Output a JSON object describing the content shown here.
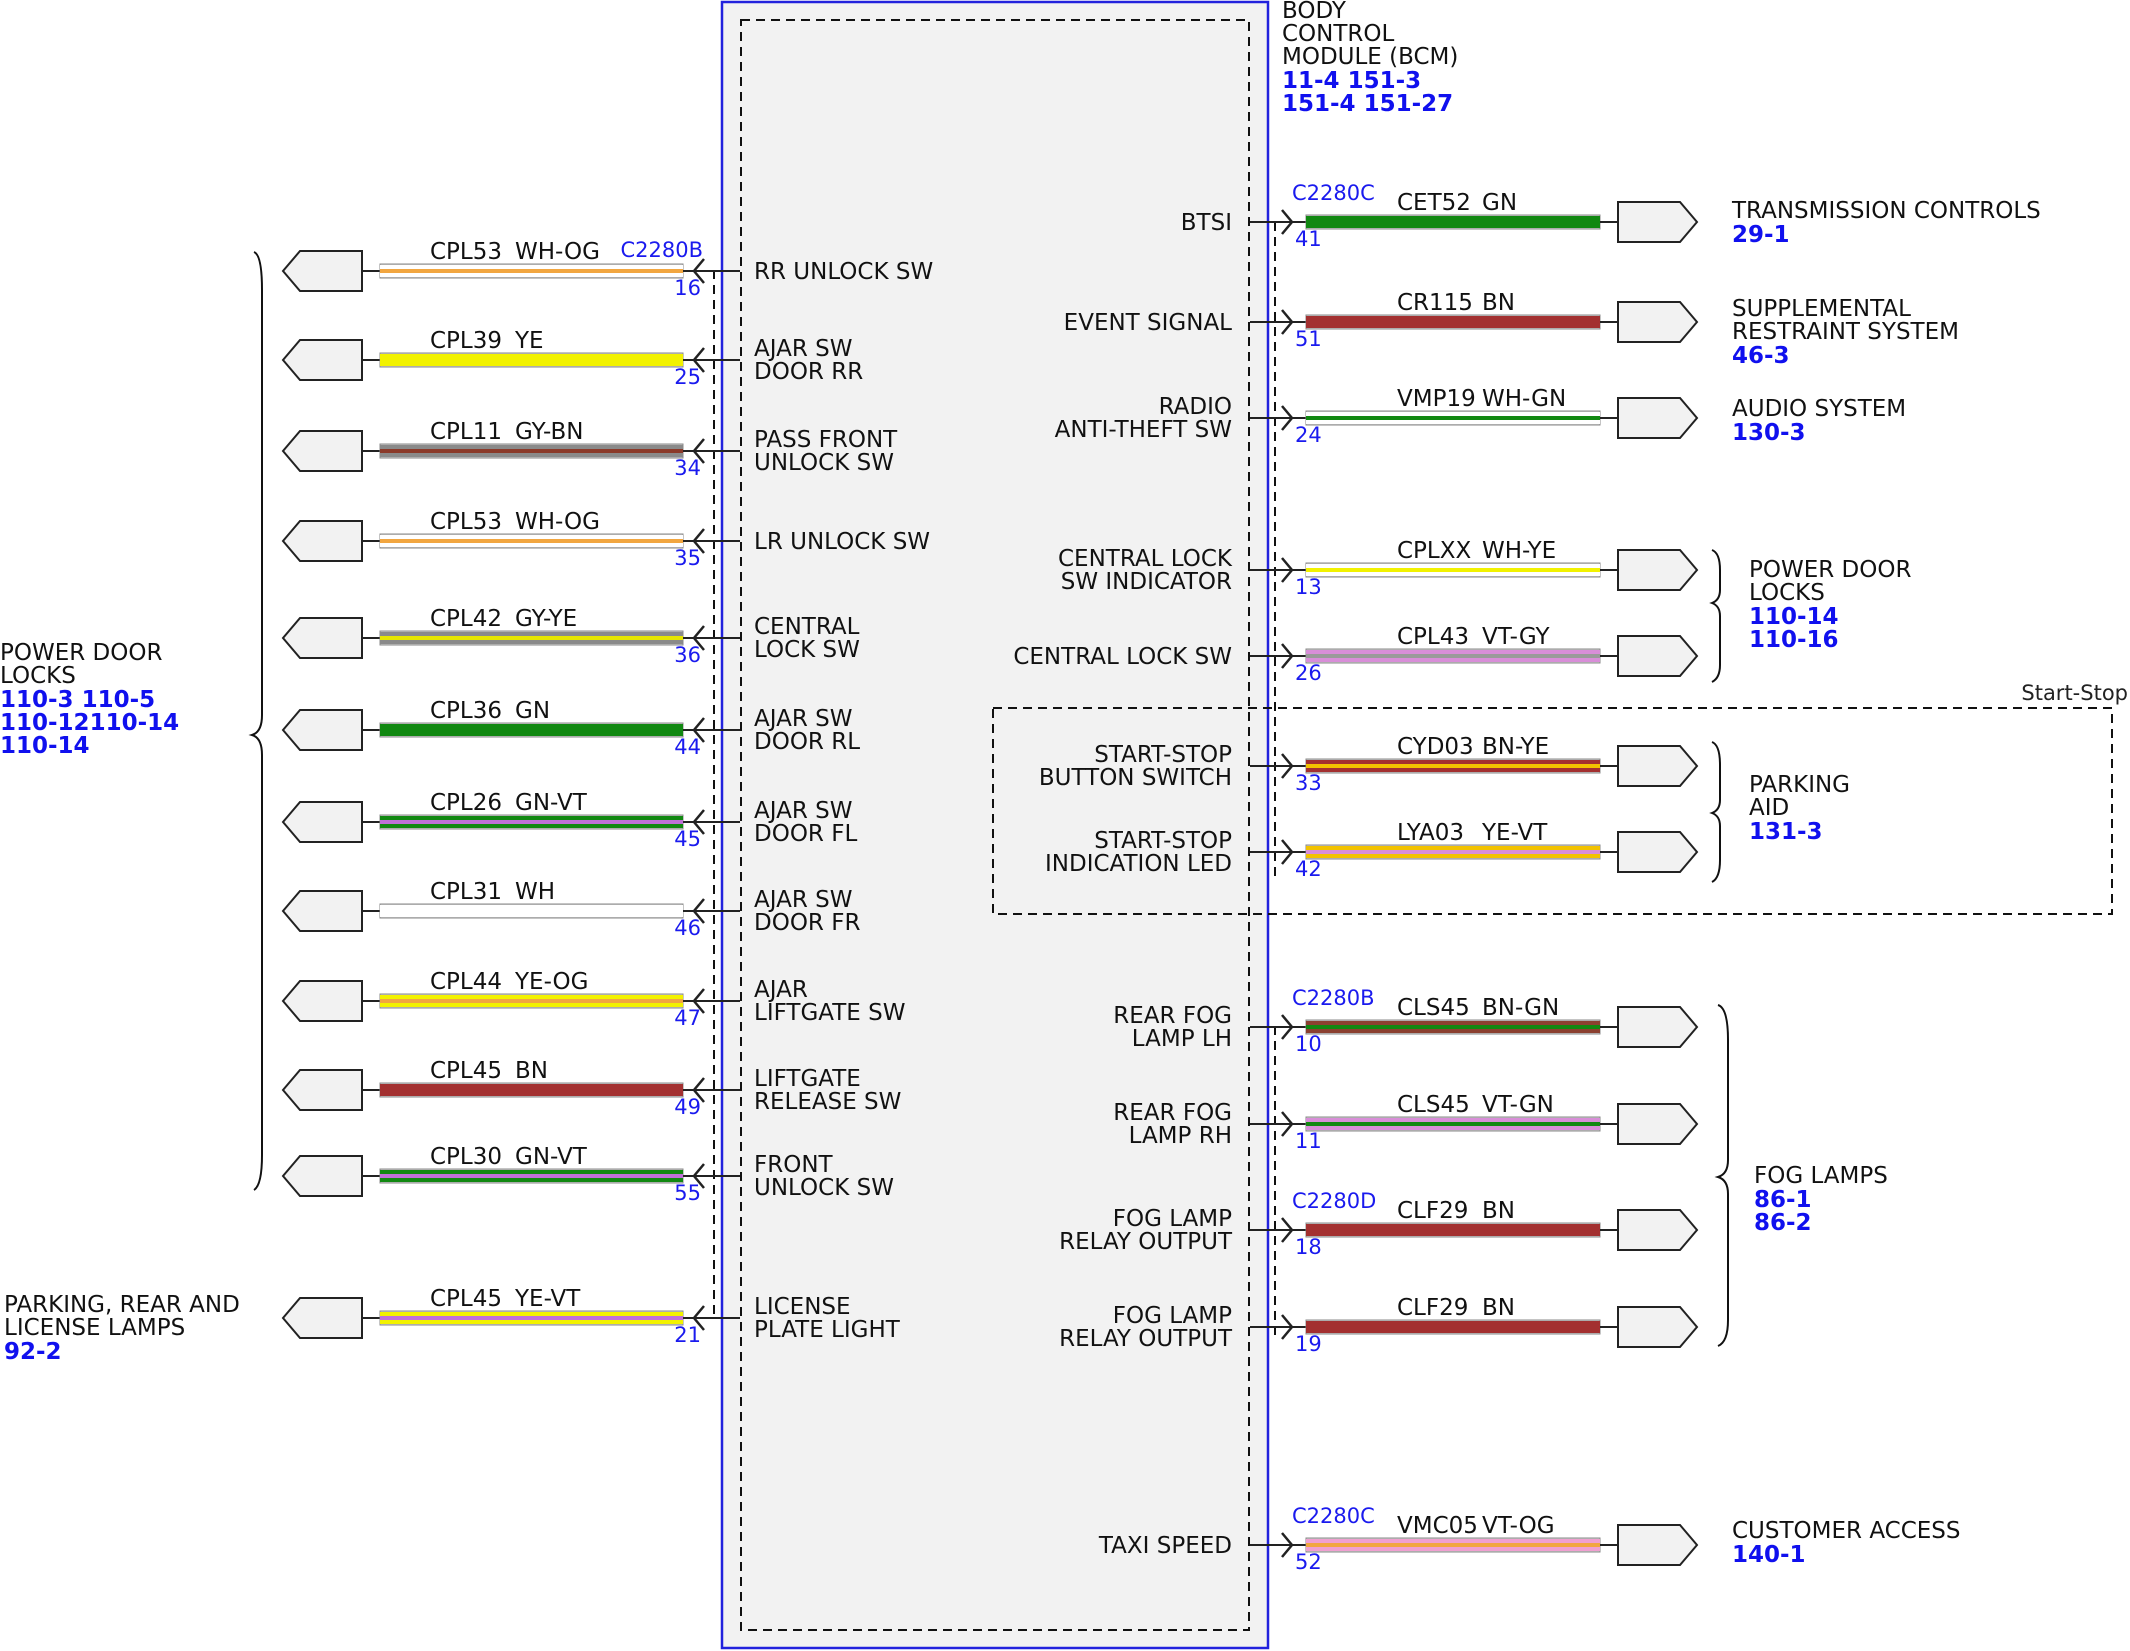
{
  "module": {
    "title_lines": [
      "BODY",
      "CONTROL",
      "MODULE (BCM)"
    ],
    "ref_lines": [
      "11-4  151-3",
      "151-4  151-27"
    ]
  },
  "left_circuits": [
    {
      "pin": "16",
      "circuit": "CPL53",
      "color": "WH-OG",
      "stripes": [
        "#ffffff",
        "#f2a640"
      ],
      "label": [
        "RR UNLOCK SW"
      ],
      "connector": "C2280B"
    },
    {
      "pin": "25",
      "circuit": "CPL39",
      "color": "YE",
      "stripes": [
        "#f2f200"
      ],
      "label": [
        "AJAR SW",
        "DOOR RR"
      ]
    },
    {
      "pin": "34",
      "circuit": "CPL11",
      "color": "GY-BN",
      "stripes": [
        "#8a8a8a",
        "#8b3a2a"
      ],
      "label": [
        "PASS FRONT",
        "UNLOCK SW"
      ]
    },
    {
      "pin": "35",
      "circuit": "CPL53",
      "color": "WH-OG",
      "stripes": [
        "#ffffff",
        "#f2a640"
      ],
      "label": [
        "LR UNLOCK SW"
      ]
    },
    {
      "pin": "36",
      "circuit": "CPL42",
      "color": "GY-YE",
      "stripes": [
        "#8a8a8a",
        "#e6e600"
      ],
      "label": [
        "CENTRAL",
        "LOCK SW"
      ]
    },
    {
      "pin": "44",
      "circuit": "CPL36",
      "color": "GN",
      "stripes": [
        "#118811"
      ],
      "label": [
        "AJAR SW",
        "DOOR RL"
      ]
    },
    {
      "pin": "45",
      "circuit": "CPL26",
      "color": "GN-VT",
      "stripes": [
        "#118811",
        "#c070d8"
      ],
      "label": [
        "AJAR SW",
        "DOOR FL"
      ]
    },
    {
      "pin": "46",
      "circuit": "CPL31",
      "color": "WH",
      "stripes": [
        "#ffffff"
      ],
      "label": [
        "AJAR SW",
        "DOOR FR"
      ]
    },
    {
      "pin": "47",
      "circuit": "CPL44",
      "color": "YE-OG",
      "stripes": [
        "#f2f200",
        "#f2a640"
      ],
      "label": [
        "AJAR",
        "LIFTGATE SW"
      ]
    },
    {
      "pin": "49",
      "circuit": "CPL45",
      "color": "BN",
      "stripes": [
        "#a33030"
      ],
      "label": [
        "LIFTGATE",
        "RELEASE SW"
      ]
    },
    {
      "pin": "55",
      "circuit": "CPL30",
      "color": "GN-VT",
      "stripes": [
        "#118811",
        "#c070d8"
      ],
      "label": [
        "FRONT",
        "UNLOCK SW"
      ]
    },
    {
      "pin": "21",
      "circuit": "CPL45",
      "color": "YE-VT",
      "stripes": [
        "#f2f200",
        "#c070d8"
      ],
      "label": [
        "LICENSE",
        "PLATE LIGHT"
      ]
    }
  ],
  "left_groups": [
    {
      "lines": [
        "POWER DOOR",
        "LOCKS"
      ],
      "refs": [
        "110-3  110-5",
        "110-12110-14",
        "110-14"
      ]
    },
    {
      "lines": [
        "PARKING, REAR AND",
        "LICENSE LAMPS"
      ],
      "refs": [
        "92-2"
      ]
    }
  ],
  "right_circuits": [
    {
      "pin": "41",
      "circuit": "CET52",
      "color": "GN",
      "stripes": [
        "#118811"
      ],
      "label": [
        "BTSI"
      ],
      "connector": "C2280C"
    },
    {
      "pin": "51",
      "circuit": "CR115",
      "color": "BN",
      "stripes": [
        "#a33030"
      ],
      "label": [
        "EVENT SIGNAL"
      ]
    },
    {
      "pin": "24",
      "circuit": "VMP19",
      "color": "WH-GN",
      "stripes": [
        "#ffffff",
        "#118811"
      ],
      "label": [
        "RADIO",
        "ANTI-THEFT SW"
      ]
    },
    {
      "pin": "13",
      "circuit": "CPLXX",
      "color": "WH-YE",
      "stripes": [
        "#ffffff",
        "#f2f200"
      ],
      "label": [
        "CENTRAL LOCK",
        "SW INDICATOR"
      ]
    },
    {
      "pin": "26",
      "circuit": "CPL43",
      "color": "VT-GY",
      "stripes": [
        "#d88ed8",
        "#9a9a9a"
      ],
      "label": [
        "CENTRAL LOCK SW"
      ]
    },
    {
      "pin": "33",
      "circuit": "CYD03",
      "color": "BN-YE",
      "stripes": [
        "#a33030",
        "#f2c200"
      ],
      "label": [
        "START-STOP",
        "BUTTON SWITCH"
      ]
    },
    {
      "pin": "42",
      "circuit": "LYA03",
      "color": "YE-VT",
      "stripes": [
        "#f2c200",
        "#d88ed8"
      ],
      "label": [
        "START-STOP",
        "INDICATION LED"
      ]
    },
    {
      "pin": "10",
      "circuit": "CLS45",
      "color": "BN-GN",
      "stripes": [
        "#8b4030",
        "#118811"
      ],
      "label": [
        "REAR FOG",
        "LAMP LH"
      ],
      "connector": "C2280B"
    },
    {
      "pin": "11",
      "circuit": "CLS45",
      "color": "VT-GN",
      "stripes": [
        "#d88ed8",
        "#118811"
      ],
      "label": [
        "REAR FOG",
        "LAMP RH"
      ]
    },
    {
      "pin": "18",
      "circuit": "CLF29",
      "color": "BN",
      "stripes": [
        "#a33030"
      ],
      "label": [
        "FOG LAMP",
        "RELAY OUTPUT"
      ],
      "connector": "C2280D"
    },
    {
      "pin": "19",
      "circuit": "CLF29",
      "color": "BN",
      "stripes": [
        "#a33030"
      ],
      "label": [
        "FOG LAMP",
        "RELAY OUTPUT"
      ]
    },
    {
      "pin": "52",
      "circuit": "VMC05",
      "color": "VT-OG",
      "stripes": [
        "#f0a0d0",
        "#f2a640"
      ],
      "label": [
        "TAXI SPEED"
      ],
      "connector": "C2280C"
    }
  ],
  "right_groups": [
    {
      "lines": [
        "TRANSMISSION CONTROLS"
      ],
      "refs": [
        "29-1"
      ]
    },
    {
      "lines": [
        "SUPPLEMENTAL",
        "RESTRAINT SYSTEM"
      ],
      "refs": [
        "46-3"
      ]
    },
    {
      "lines": [
        "AUDIO SYSTEM"
      ],
      "refs": [
        "130-3"
      ]
    },
    {
      "lines": [
        "POWER DOOR",
        "LOCKS"
      ],
      "refs": [
        "110-14",
        "110-16"
      ]
    },
    {
      "lines": [
        "PARKING",
        "AID"
      ],
      "refs": [
        "131-3"
      ]
    },
    {
      "lines": [
        "FOG LAMPS"
      ],
      "refs": [
        "86-1",
        "86-2"
      ]
    },
    {
      "lines": [
        "CUSTOMER ACCESS"
      ],
      "refs": [
        "140-1"
      ]
    }
  ],
  "start_stop_label": "Start-Stop"
}
